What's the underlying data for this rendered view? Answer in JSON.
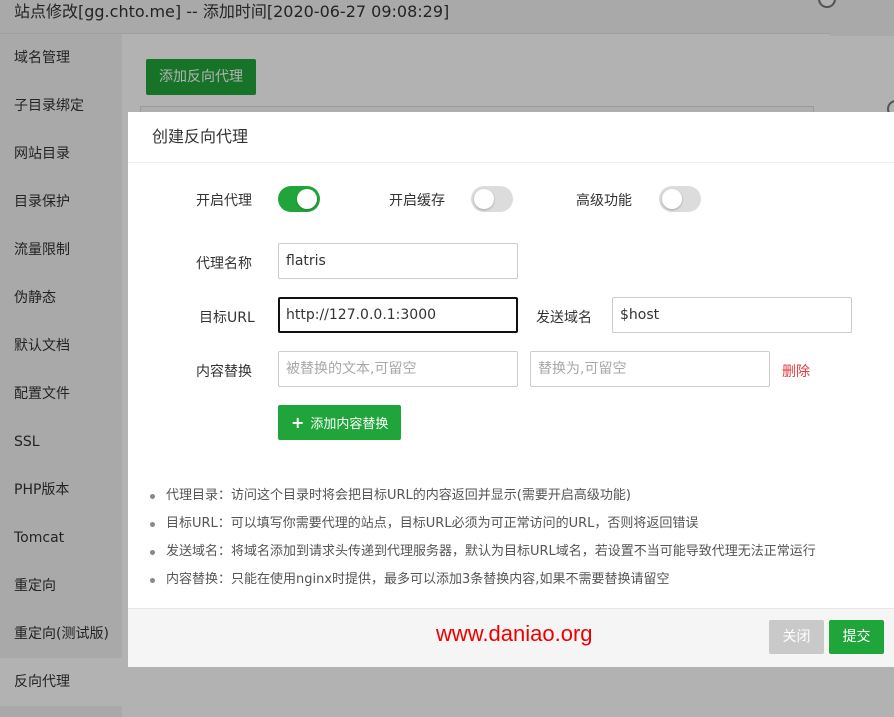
{
  "window": {
    "title": "站点修改[gg.chto.me] -- 添加时间[2020-06-27 09:08:29]",
    "sidebar": [
      {
        "label": "域名管理"
      },
      {
        "label": "子目录绑定"
      },
      {
        "label": "网站目录"
      },
      {
        "label": "目录保护"
      },
      {
        "label": "流量限制"
      },
      {
        "label": "伪静态"
      },
      {
        "label": "默认文档"
      },
      {
        "label": "配置文件"
      },
      {
        "label": "SSL"
      },
      {
        "label": "PHP版本"
      },
      {
        "label": "Tomcat"
      },
      {
        "label": "重定向"
      },
      {
        "label": "重定向(测试版)"
      },
      {
        "label": "反向代理"
      }
    ],
    "active_item": "反向代理",
    "add_proxy_button": "添加反向代理"
  },
  "modal": {
    "title": "创建反向代理",
    "toggles": {
      "enable_proxy": {
        "label": "开启代理",
        "on": true
      },
      "enable_cache": {
        "label": "开启缓存",
        "on": false
      },
      "advanced": {
        "label": "高级功能",
        "on": false
      }
    },
    "proxy_name": {
      "label": "代理名称",
      "value": "flatris"
    },
    "target_url": {
      "label": "目标URL",
      "value": "http://127.0.0.1:3000"
    },
    "send_domain": {
      "label": "发送域名",
      "value": "$host"
    },
    "content_replace": {
      "label": "内容替换",
      "from_placeholder": "被替换的文本,可留空",
      "to_placeholder": "替换为,可留空",
      "delete_label": "删除"
    },
    "add_replace_button": "添加内容替换",
    "tips": [
      "代理目录：访问这个目录时将会把目标URL的内容返回并显示(需要开启高级功能)",
      "目标URL：可以填写你需要代理的站点，目标URL必须为可正常访问的URL，否则将返回错误",
      "发送域名：将域名添加到请求头传递到代理服务器，默认为目标URL域名，若设置不当可能导致代理无法正常运行",
      "内容替换：只能在使用nginx时提供，最多可以添加3条替换内容,如果不需要替换请留空"
    ],
    "watermark": "www.daniao.org",
    "close_button": "关闭",
    "submit_button": "提交"
  },
  "colors": {
    "accent": "#20a53a",
    "danger": "#e4393c",
    "watermark": "#ee0000"
  }
}
